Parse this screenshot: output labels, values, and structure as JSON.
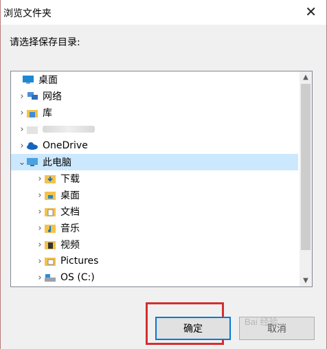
{
  "window": {
    "title": "浏览文件夹",
    "close_glyph": "✕"
  },
  "prompt": "请选择保存目录:",
  "tree": [
    {
      "label": "桌面",
      "icon": "desktop-icon",
      "level": 0,
      "arrow": ""
    },
    {
      "label": "网络",
      "icon": "network-icon",
      "level": 1,
      "arrow": ">"
    },
    {
      "label": "库",
      "icon": "library-icon",
      "level": 1,
      "arrow": ">"
    },
    {
      "label": "",
      "icon": "user-folder-icon",
      "level": 1,
      "arrow": ">"
    },
    {
      "label": "OneDrive",
      "icon": "onedrive-icon",
      "level": 1,
      "arrow": ">"
    },
    {
      "label": "此电脑",
      "icon": "computer-icon",
      "level": 1,
      "arrow": "v",
      "selected": true
    },
    {
      "label": "下载",
      "icon": "downloads-icon",
      "level": 2,
      "arrow": ">"
    },
    {
      "label": "桌面",
      "icon": "desktop-folder-icon",
      "level": 2,
      "arrow": ">"
    },
    {
      "label": "文档",
      "icon": "documents-icon",
      "level": 2,
      "arrow": ">"
    },
    {
      "label": "音乐",
      "icon": "music-icon",
      "level": 2,
      "arrow": ">"
    },
    {
      "label": "视频",
      "icon": "videos-icon",
      "level": 2,
      "arrow": ">"
    },
    {
      "label": "Pictures",
      "icon": "pictures-icon",
      "level": 2,
      "arrow": ">"
    },
    {
      "label": "OS (C:)",
      "icon": "drive-icon",
      "level": 2,
      "arrow": ">"
    }
  ],
  "buttons": {
    "ok": "确定",
    "cancel": "取消"
  },
  "watermark": "Bai 经验"
}
